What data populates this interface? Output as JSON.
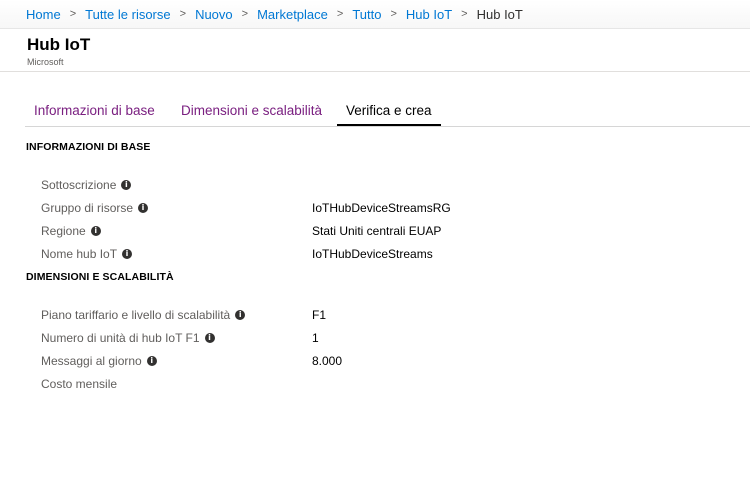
{
  "breadcrumb": {
    "items": [
      "Home",
      "Tutte le risorse",
      "Nuovo",
      "Marketplace",
      "Tutto",
      "Hub IoT"
    ],
    "current": "Hub IoT",
    "separator": ">"
  },
  "header": {
    "title": "Hub IoT",
    "publisher": "Microsoft"
  },
  "tabs": [
    {
      "label": "Informazioni di base",
      "active": false
    },
    {
      "label": "Dimensioni e scalabilità",
      "active": false
    },
    {
      "label": "Verifica e crea",
      "active": true
    }
  ],
  "basics": {
    "section_title": "INFORMAZIONI DI BASE",
    "rows": [
      {
        "label": "Sottoscrizione",
        "value": "",
        "icon": "info-icon"
      },
      {
        "label": "Gruppo di risorse",
        "value": "IoTHubDeviceStreamsRG",
        "icon": "info-icon"
      },
      {
        "label": "Regione",
        "value": "Stati Uniti centrali EUAP",
        "icon": "info-icon"
      },
      {
        "label": "Nome hub IoT",
        "value": "IoTHubDeviceStreams",
        "icon": "info-icon"
      }
    ]
  },
  "scale": {
    "section_title": "DIMENSIONI E SCALABILITÀ",
    "rows": [
      {
        "label": "Piano tariffario e livello di scalabilità",
        "value": "F1",
        "icon": "info-icon"
      },
      {
        "label": "Numero di unità di hub IoT F1",
        "value": "1",
        "icon": "info-icon"
      },
      {
        "label": "Messaggi al giorno",
        "value": "8.000",
        "icon": "info-icon"
      },
      {
        "label": "Costo mensile",
        "value": "",
        "icon": ""
      }
    ]
  },
  "colors": {
    "link": "#0078d4",
    "tab_inactive": "#7a1f80",
    "tab_active": "#000000",
    "label": "#605e5c"
  }
}
